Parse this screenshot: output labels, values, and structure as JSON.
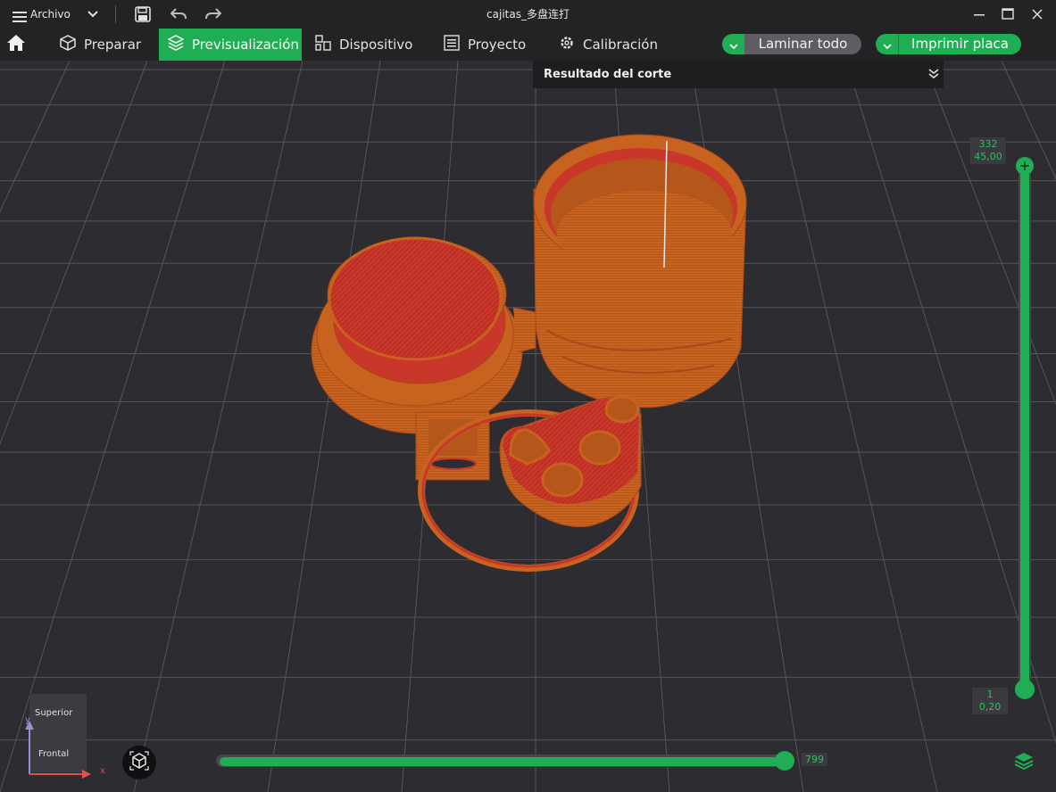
{
  "titlebar": {
    "menu_label": "Archivo",
    "title": "cajitas_多盘连打",
    "icons": [
      "hamburger-icon",
      "chevron-down-icon",
      "save-icon",
      "undo-icon",
      "redo-icon",
      "minimize-icon",
      "maximize-icon",
      "close-icon"
    ]
  },
  "nav": {
    "tabs": [
      {
        "label": "Preparar",
        "icon": "cube-icon",
        "active": false
      },
      {
        "label": "Previsualización",
        "icon": "layers-icon",
        "active": true
      },
      {
        "label": "Dispositivo",
        "icon": "device-icon",
        "active": false
      },
      {
        "label": "Proyecto",
        "icon": "list-icon",
        "active": false
      },
      {
        "label": "Calibración",
        "icon": "gear-icon",
        "active": false
      }
    ],
    "slice_button": "Laminar todo",
    "print_button": "Imprimir placa"
  },
  "slice_result": {
    "title": "Resultado del corte"
  },
  "layer_slider": {
    "top_layer": "332",
    "top_height": "45,00",
    "bottom_layer": "1",
    "bottom_height": "0,20"
  },
  "move_slider": {
    "value": "799",
    "fraction": 1.0
  },
  "view_cube": {
    "top_label": "Superior",
    "front_label": "Frontal",
    "axis_x": "x",
    "axis_y": "y"
  },
  "colors": {
    "accent": "#1fae54",
    "model_orange": "#c8621f",
    "model_red": "#c8372a",
    "background": "#2d2d31",
    "bar": "#232326"
  }
}
